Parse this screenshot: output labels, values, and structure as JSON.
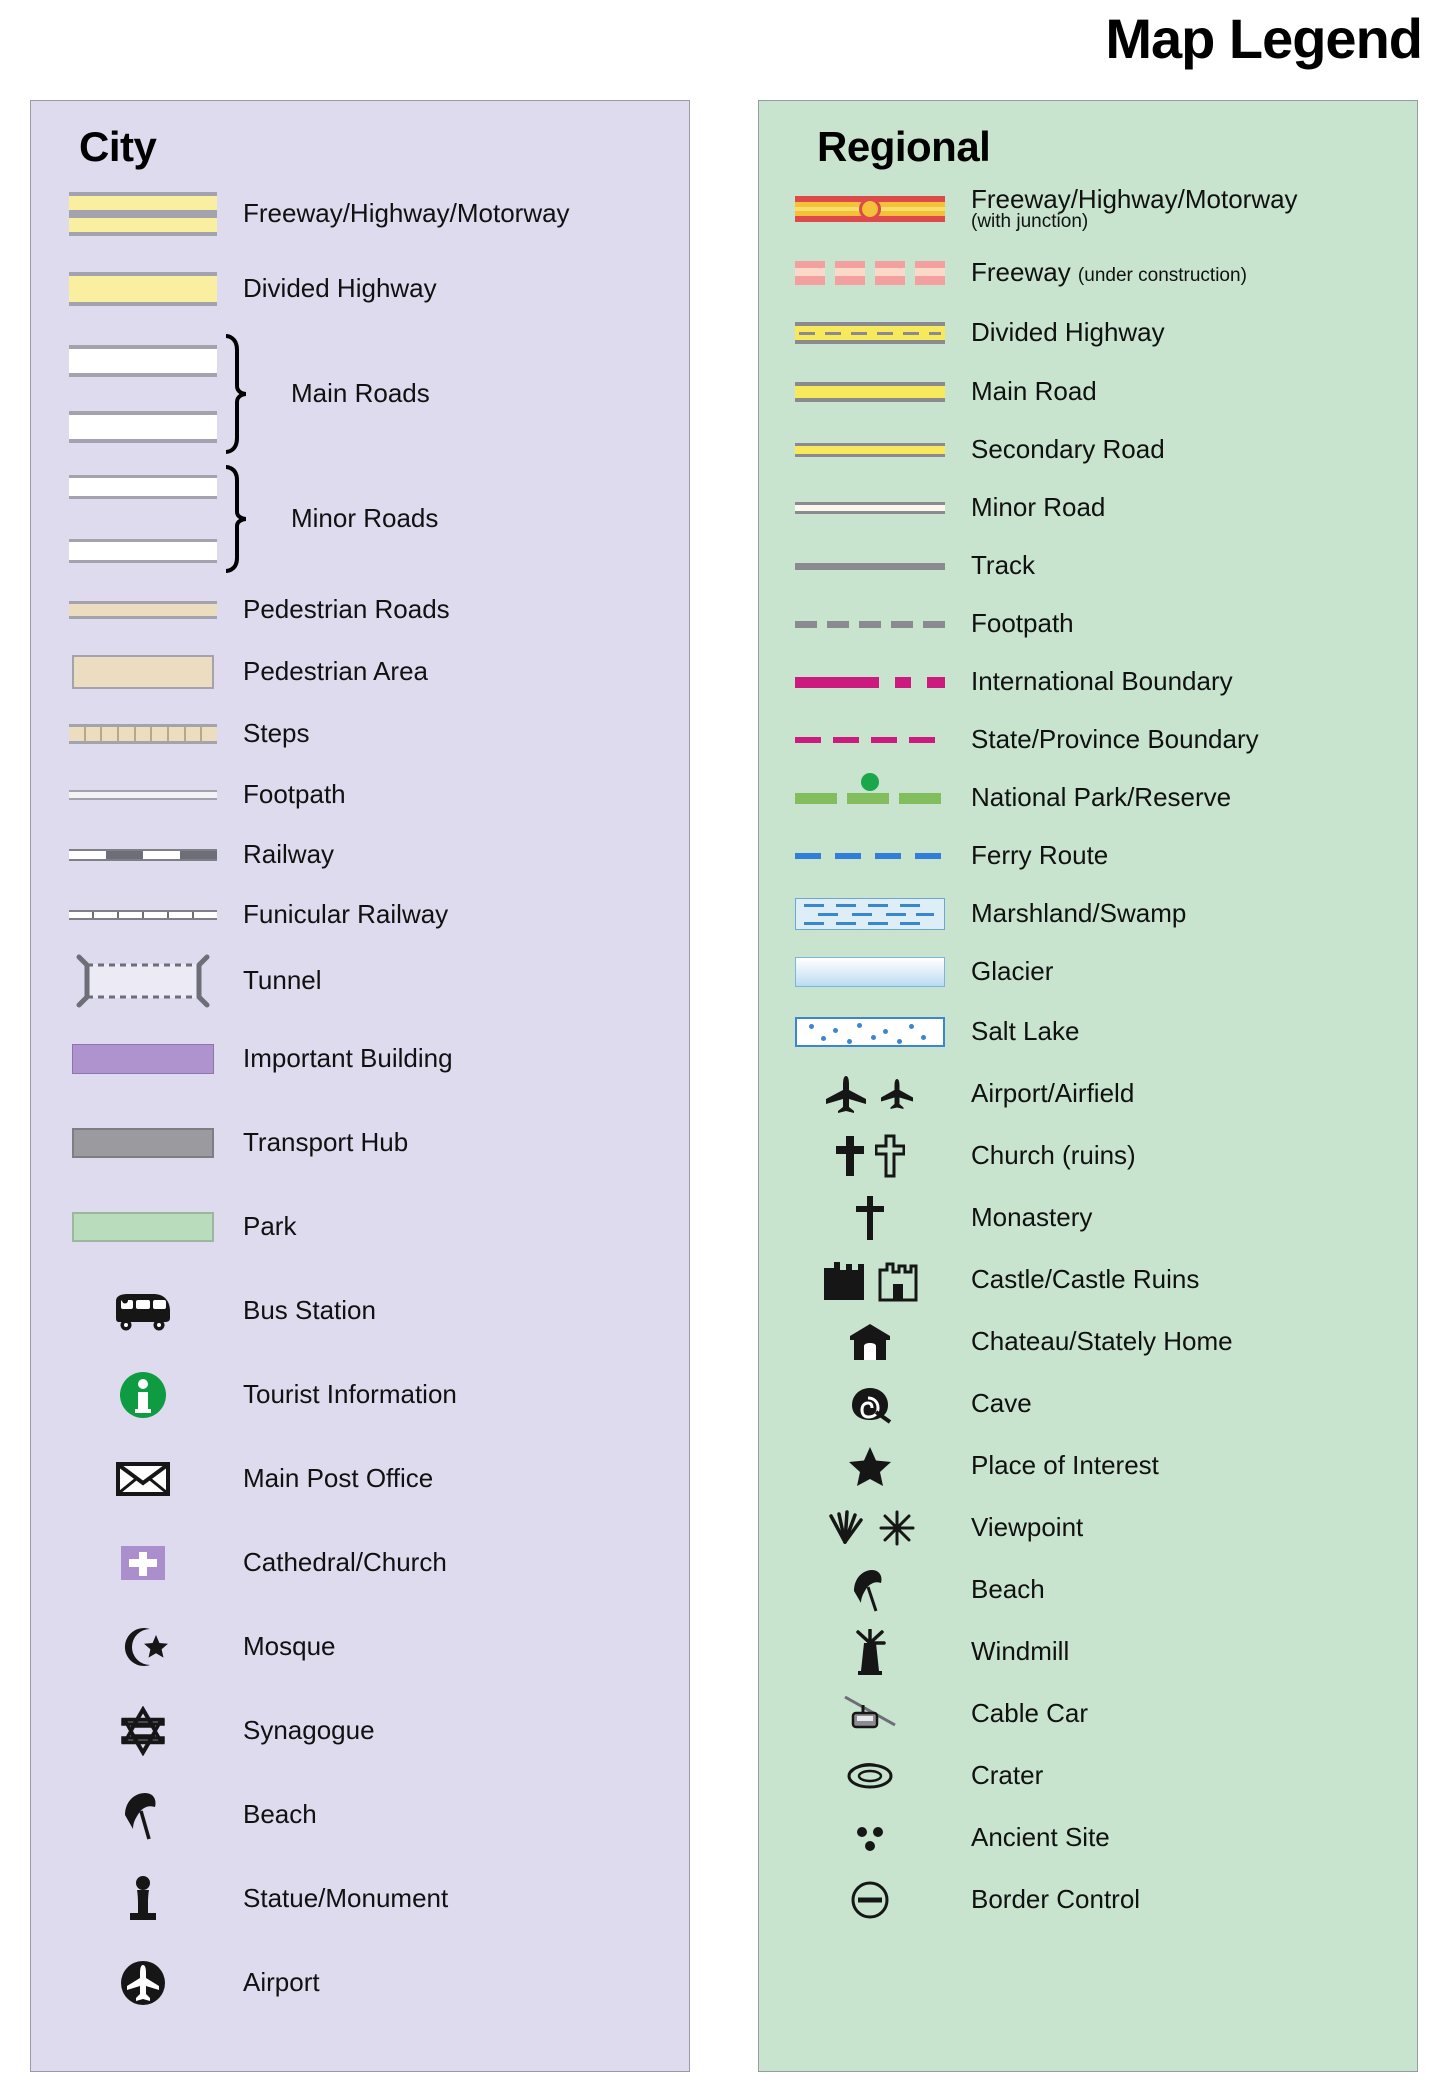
{
  "title": "Map Legend",
  "colors": {
    "city_panel_bg": "#dedbee",
    "regional_panel_bg": "#c8e4ce",
    "panel_border": "#9a9aa5",
    "road_casing_grey": "#a3a3ad",
    "highway_yellow_city": "#faeea0",
    "pedestrian_tan": "#ecdcc0",
    "important_building_purple": "#ae93cf",
    "transport_hub_grey": "#9a9a9f",
    "park_green": "#b9dcbc",
    "tourist_info_green": "#0f9b42",
    "freeway_red": "#de4a4a",
    "freeway_orange": "#f5c13a",
    "regional_road_yellow": "#f7e85c",
    "regional_casing_grey": "#8a8a90",
    "boundary_magenta": "#cc1b7e",
    "national_park_green": "#82bd5e",
    "national_park_dot_green": "#1aa64a",
    "ferry_blue": "#2f7fd8",
    "marsh_blue": "#3a87cf",
    "glacier_blue": "#b9dcf2",
    "icon_black": "#161616"
  },
  "city": {
    "title": "City",
    "items": [
      {
        "label": "Freeway/Highway/Motorway",
        "symbol": "freeway-bar"
      },
      {
        "label": "Divided Highway",
        "symbol": "divided-highway-bar"
      },
      {
        "label": "Main Roads",
        "symbol": "main-roads-grouped-bars"
      },
      {
        "label": "Minor Roads",
        "symbol": "minor-roads-grouped-bars"
      },
      {
        "label": "Pedestrian Roads",
        "symbol": "pedestrian-road-bar"
      },
      {
        "label": "Pedestrian Area",
        "symbol": "pedestrian-area-block"
      },
      {
        "label": "Steps",
        "symbol": "steps-bar"
      },
      {
        "label": "Footpath",
        "symbol": "footpath-line"
      },
      {
        "label": "Railway",
        "symbol": "railway-line"
      },
      {
        "label": "Funicular Railway",
        "symbol": "funicular-line"
      },
      {
        "label": "Tunnel",
        "symbol": "tunnel-brackets"
      },
      {
        "label": "Important Building",
        "symbol": "purple-block"
      },
      {
        "label": "Transport Hub",
        "symbol": "grey-block"
      },
      {
        "label": "Park",
        "symbol": "green-block"
      },
      {
        "label": "Bus Station",
        "symbol": "bus-icon"
      },
      {
        "label": "Tourist Information",
        "symbol": "tourist-information-icon"
      },
      {
        "label": "Main Post Office",
        "symbol": "envelope-icon"
      },
      {
        "label": "Cathedral/Church",
        "symbol": "church-icon"
      },
      {
        "label": "Mosque",
        "symbol": "mosque-icon"
      },
      {
        "label": "Synagogue",
        "symbol": "star-of-david-icon"
      },
      {
        "label": "Beach",
        "symbol": "beach-umbrella-icon"
      },
      {
        "label": "Statue/Monument",
        "symbol": "statue-icon"
      },
      {
        "label": "Airport",
        "symbol": "airport-icon"
      }
    ]
  },
  "regional": {
    "title": "Regional",
    "items": [
      {
        "label": "Freeway/Highway/Motorway",
        "sublabel": "(with junction)",
        "symbol": "freeway-with-junction"
      },
      {
        "label": "Freeway ",
        "sublabel": "(under construction)",
        "symbol": "freeway-dashed"
      },
      {
        "label": "Divided Highway",
        "symbol": "divided-highway-line"
      },
      {
        "label": "Main Road",
        "symbol": "main-road-line"
      },
      {
        "label": "Secondary Road",
        "symbol": "secondary-road-line"
      },
      {
        "label": "Minor Road",
        "symbol": "minor-road-line"
      },
      {
        "label": "Track",
        "symbol": "track-line"
      },
      {
        "label": "Footpath",
        "symbol": "footpath-dashed-line"
      },
      {
        "label": "International Boundary",
        "symbol": "dash-dot-magenta-line"
      },
      {
        "label": "State/Province Boundary",
        "symbol": "dashed-magenta-line"
      },
      {
        "label": "National Park/Reserve",
        "symbol": "green-dashed-line-with-dot"
      },
      {
        "label": "Ferry Route",
        "symbol": "dashed-blue-line"
      },
      {
        "label": "Marshland/Swamp",
        "symbol": "marsh-hatch-block"
      },
      {
        "label": "Glacier",
        "symbol": "glacier-gradient-block"
      },
      {
        "label": "Salt Lake",
        "symbol": "salt-lake-dotted-block"
      },
      {
        "label": "Airport/Airfield",
        "symbol": "airplane-icons"
      },
      {
        "label": "Church (ruins)",
        "symbol": "cross-icons"
      },
      {
        "label": "Monastery",
        "symbol": "monastery-cross-icon"
      },
      {
        "label": "Castle/Castle Ruins",
        "symbol": "castle-icons"
      },
      {
        "label": "Chateau/Stately Home",
        "symbol": "chateau-icon"
      },
      {
        "label": "Cave",
        "symbol": "cave-icon"
      },
      {
        "label": "Place of Interest",
        "symbol": "star-icon"
      },
      {
        "label": "Viewpoint",
        "symbol": "viewpoint-icons"
      },
      {
        "label": "Beach",
        "symbol": "beach-umbrella-icon"
      },
      {
        "label": "Windmill",
        "symbol": "windmill-icon"
      },
      {
        "label": "Cable Car",
        "symbol": "cable-car-icon"
      },
      {
        "label": "Crater",
        "symbol": "crater-icon"
      },
      {
        "label": "Ancient Site",
        "symbol": "ancient-site-icon"
      },
      {
        "label": "Border Control",
        "symbol": "border-control-icon"
      }
    ]
  }
}
